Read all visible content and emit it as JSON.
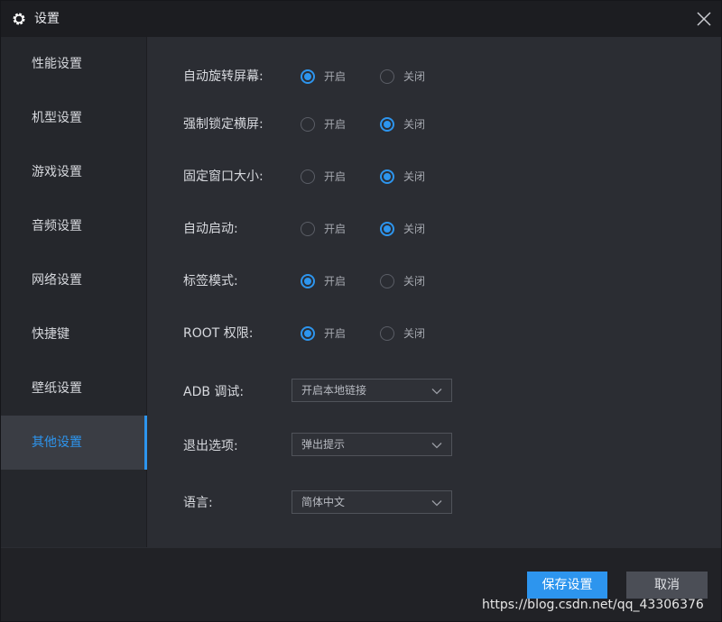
{
  "window": {
    "title": "设置",
    "icon": "gear-icon",
    "close_icon": "close-icon"
  },
  "sidebar": {
    "items": [
      {
        "label": "性能设置",
        "active": false
      },
      {
        "label": "机型设置",
        "active": false
      },
      {
        "label": "游戏设置",
        "active": false
      },
      {
        "label": "音频设置",
        "active": false
      },
      {
        "label": "网络设置",
        "active": false
      },
      {
        "label": "快捷键",
        "active": false
      },
      {
        "label": "壁纸设置",
        "active": false
      },
      {
        "label": "其他设置",
        "active": true
      }
    ]
  },
  "settings": {
    "radio_rows": [
      {
        "label": "自动旋转屏幕:",
        "on_label": "开启",
        "off_label": "关闭",
        "selected": "on"
      },
      {
        "label": "强制锁定横屏:",
        "on_label": "开启",
        "off_label": "关闭",
        "selected": "off"
      },
      {
        "label": "固定窗口大小:",
        "on_label": "开启",
        "off_label": "关闭",
        "selected": "off"
      },
      {
        "label": "自动启动:",
        "on_label": "开启",
        "off_label": "关闭",
        "selected": "off"
      },
      {
        "label": "标签模式:",
        "on_label": "开启",
        "off_label": "关闭",
        "selected": "on"
      },
      {
        "label": "ROOT 权限:",
        "on_label": "开启",
        "off_label": "关闭",
        "selected": "on"
      }
    ],
    "selects": [
      {
        "label": "ADB 调试:",
        "value": "开启本地链接"
      },
      {
        "label": "退出选项:",
        "value": "弹出提示"
      },
      {
        "label": "语言:",
        "value": "简体中文"
      }
    ]
  },
  "footer": {
    "save_label": "保存设置",
    "cancel_label": "取消",
    "watermark": "https://blog.csdn.net/qq_43306376"
  },
  "colors": {
    "accent": "#2d95ee",
    "background": "#2b2d33",
    "sidebar": "#25272c",
    "titlebar": "#1c1d21"
  }
}
